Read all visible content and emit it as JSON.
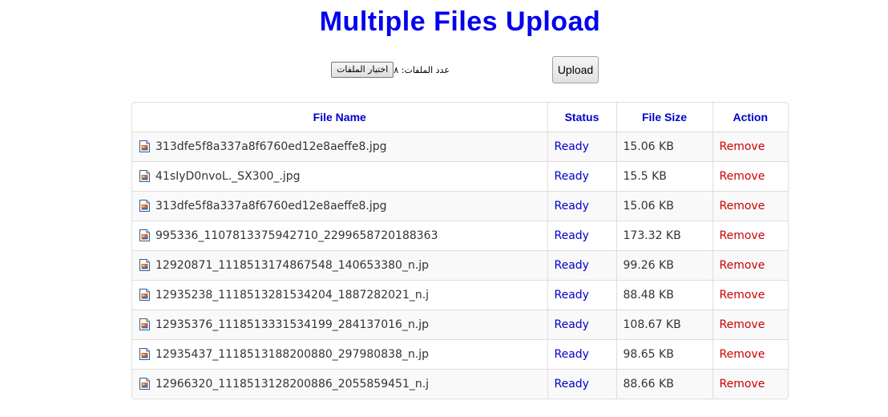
{
  "title": "Multiple Files Upload",
  "picker": {
    "choose_label": "اختيار الملفات",
    "count_text": "عدد الملفات: ٨"
  },
  "upload_label": "Upload",
  "table": {
    "headers": {
      "file_name": "File Name",
      "status": "Status",
      "file_size": "File Size",
      "action": "Action"
    },
    "rows": [
      {
        "name": "313dfe5f8a337a8f6760ed12e8aeffe8.jpg",
        "status": "Ready",
        "size": "15.06 KB",
        "action": "Remove"
      },
      {
        "name": "41sIyD0nvoL._SX300_.jpg",
        "status": "Ready",
        "size": "15.5 KB",
        "action": "Remove"
      },
      {
        "name": "313dfe5f8a337a8f6760ed12e8aeffe8.jpg",
        "status": "Ready",
        "size": "15.06 KB",
        "action": "Remove"
      },
      {
        "name": "995336_1107813375942710_2299658720188363",
        "status": "Ready",
        "size": "173.32 KB",
        "action": "Remove"
      },
      {
        "name": "12920871_1118513174867548_140653380_n.jp",
        "status": "Ready",
        "size": "99.26 KB",
        "action": "Remove"
      },
      {
        "name": "12935238_1118513281534204_1887282021_n.j",
        "status": "Ready",
        "size": "88.48 KB",
        "action": "Remove"
      },
      {
        "name": "12935376_1118513331534199_284137016_n.jp",
        "status": "Ready",
        "size": "108.67 KB",
        "action": "Remove"
      },
      {
        "name": "12935437_1118513188200880_297980838_n.jp",
        "status": "Ready",
        "size": "98.65 KB",
        "action": "Remove"
      },
      {
        "name": "12966320_1118513128200886_2055859451_n.j",
        "status": "Ready",
        "size": "88.66 KB",
        "action": "Remove"
      }
    ]
  },
  "colors": {
    "title": "#0000ee",
    "header": "#0000cc",
    "status": "#0000cc",
    "remove": "#cc0000"
  },
  "icons": {
    "file": "image-file-icon"
  }
}
